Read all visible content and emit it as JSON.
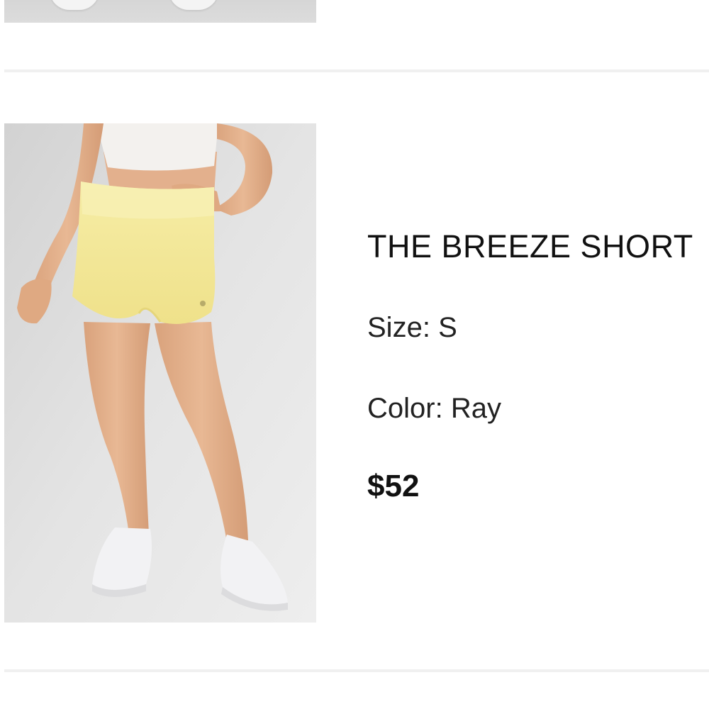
{
  "product": {
    "name": "THE BREEZE SHORT",
    "size_label": "Size:",
    "size_value": "S",
    "color_label": "Color:",
    "color_value": "Ray",
    "price": "$52",
    "image_icon": "product-photo"
  },
  "colors": {
    "shorts": "#f5eca0",
    "background": "#e2e2e2",
    "text": "#111111"
  }
}
